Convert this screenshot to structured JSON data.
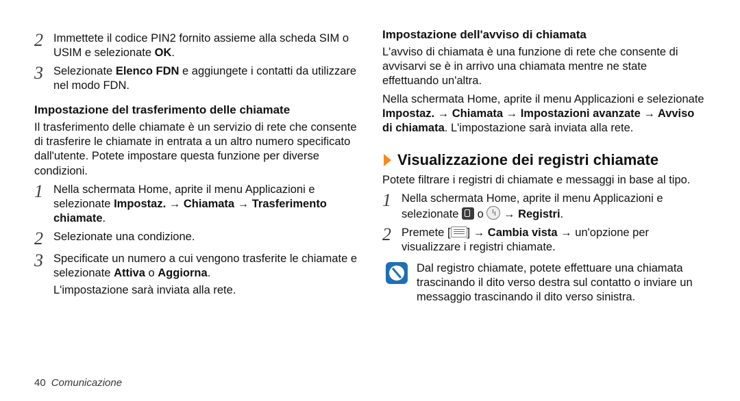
{
  "left": {
    "step2": "Immettete il codice PIN2 fornito assieme alla scheda SIM o USIM e selezionate ",
    "step2_bold": "OK",
    "step2_tail": ".",
    "step3_a": "Selezionate ",
    "step3_bold": "Elenco FDN",
    "step3_b": " e aggiungete i contatti da utilizzare nel modo FDN.",
    "sub1": "Impostazione del trasferimento delle chiamate",
    "sub1_body": "Il trasferimento delle chiamate è un servizio di rete che consente di trasferire le chiamate in entrata a un altro numero specificato dall'utente. Potete impostare questa funzione per diverse condizioni.",
    "s1_a": "Nella schermata Home, aprite il menu Applicazioni e selezionate ",
    "s1_bold": "Impostaz. → Chiamata → Trasferimento chiamate",
    "s1_tail": ".",
    "s2": "Selezionate una condizione.",
    "s3_a": "Specificate un numero a cui vengono trasferite le chiamate e selezionate ",
    "s3_bold1": "Attiva",
    "s3_mid": " o ",
    "s3_bold2": "Aggiorna",
    "s3_tail": ".",
    "s3_after": "L'impostazione sarà inviata alla rete."
  },
  "right": {
    "sub2": "Impostazione dell'avviso di chiamata",
    "sub2_body": "L'avviso di chiamata è una funzione di rete che consente di avvisarvi se è in arrivo una chiamata mentre ne state effettuando un'altra.",
    "sub2_p2_a": "Nella schermata Home, aprite il menu Applicazioni e selezionate ",
    "sub2_p2_bold": "Impostaz. → Chiamata → Impostazioni avanzate → Avviso di chiamata",
    "sub2_p2_b": ". L'impostazione sarà inviata alla rete.",
    "chev_title": "Visualizzazione dei registri chiamate",
    "chev_body": "Potete filtrare i registri di chiamate e messaggi in base al tipo.",
    "r1_a": "Nella schermata Home, aprite il menu Applicazioni e selezionate ",
    "r1_mid": " o ",
    "r1_arrow": " → ",
    "r1_bold": "Registri",
    "r1_tail": ".",
    "r2_a": "Premete [",
    "r2_b": "] → ",
    "r2_bold": "Cambia vista",
    "r2_c": " → un'opzione per visualizzare i registri chiamate.",
    "note": "Dal registro chiamate, potete effettuare una chiamata trascinando il dito verso destra sul contatto o inviare un messaggio trascinando il dito verso sinistra."
  },
  "footer": {
    "page": "40",
    "section": "Comunicazione"
  }
}
